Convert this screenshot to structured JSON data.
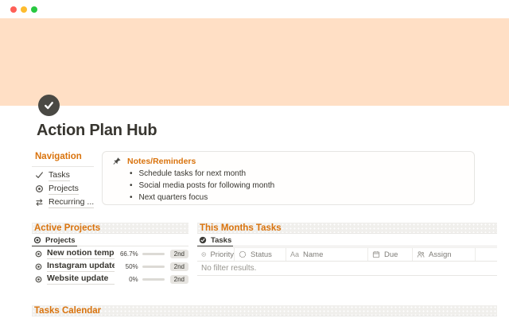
{
  "page": {
    "title": "Action Plan Hub",
    "cover_color": "#ffdfc5",
    "accent_color": "#d9730d",
    "icon": "check-circle-icon"
  },
  "navigation": {
    "heading": "Navigation",
    "items": [
      {
        "icon": "check-icon",
        "label": "Tasks"
      },
      {
        "icon": "target-icon",
        "label": "Projects"
      },
      {
        "icon": "repeat-icon",
        "label": "Recurring ..."
      }
    ]
  },
  "callout": {
    "icon": "pushpin-icon",
    "title": "Notes/Reminders",
    "bullets": [
      "Schedule tasks for next month",
      "Social media posts for following month",
      "Next quarters focus"
    ]
  },
  "active_projects": {
    "heading": "Active Projects",
    "tab_label": "Projects",
    "rows": [
      {
        "name": "New notion template",
        "percent_label": "66.7%",
        "percent": 66.7,
        "badge": "2nd"
      },
      {
        "name": "Instagram update",
        "percent_label": "50%",
        "percent": 50,
        "badge": "2nd"
      },
      {
        "name": "Website update",
        "percent_label": "0%",
        "percent": 0,
        "badge": "2nd"
      }
    ]
  },
  "month_tasks": {
    "heading": "This Months Tasks",
    "tab_label": "Tasks",
    "columns": [
      {
        "icon": "priority-icon",
        "label": "Priority"
      },
      {
        "icon": "status-icon",
        "label": "Status"
      },
      {
        "icon": "text-icon",
        "label": "Name"
      },
      {
        "icon": "calendar-icon",
        "label": "Due"
      },
      {
        "icon": "people-icon",
        "label": "Assign"
      }
    ],
    "empty_text": "No filter results."
  },
  "tasks_calendar": {
    "heading": "Tasks Calendar"
  }
}
